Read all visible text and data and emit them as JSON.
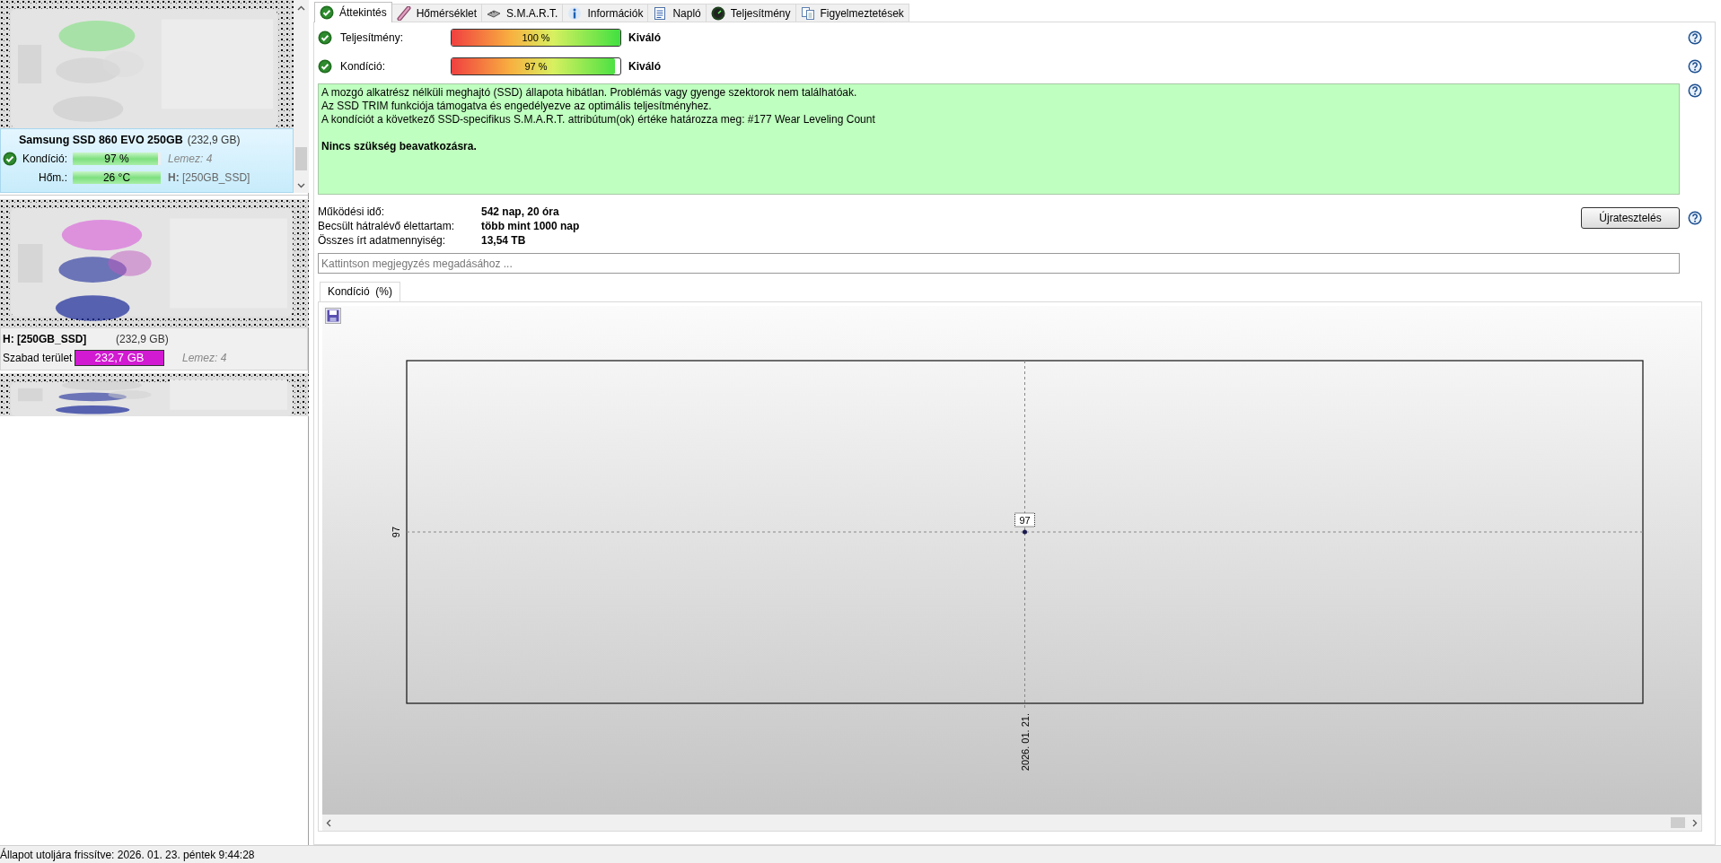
{
  "sidebar": {
    "disk": {
      "name": "Samsung SSD 860 EVO 250GB",
      "size": "(232,9 GB)",
      "selected": true,
      "condition": {
        "label": "Kondíció:",
        "value": "97 %",
        "level": 0.97
      },
      "disk_number": "Lemez: 4",
      "temperature": {
        "label": "Hőm.:",
        "value": "26 °C"
      },
      "volume": "**H:** [250GB_SSD]"
    },
    "partition": {
      "name": "H: [250GB_SSD]",
      "size": "(232,9 GB)",
      "selected": false,
      "free": {
        "label": "Szabad terület",
        "value": "232,7 GB",
        "level": 0.999
      },
      "disk_number": "Lemez: 4"
    }
  },
  "tabs": [
    {
      "label": "Áttekintés",
      "selected": true
    },
    {
      "label": "Hőmérséklet",
      "selected": false
    },
    {
      "label": "S.M.A.R.T.",
      "selected": false
    },
    {
      "label": "Információk",
      "selected": false
    },
    {
      "label": "Napló",
      "selected": false
    },
    {
      "label": "Teljesítmény",
      "selected": false
    },
    {
      "label": "Figyelmeztetések",
      "selected": false
    }
  ],
  "metrics": [
    {
      "label": "Teljesítmény:",
      "value": "100 %",
      "level": 1,
      "rating": "Kiváló"
    },
    {
      "label": "Kondíció:",
      "value": "97 %",
      "level": 0.97,
      "rating": "Kiváló"
    }
  ],
  "message": {
    "lines": [
      "A mozgó alkatrész nélküli meghajtó (SSD) állapota hibátlan. Problémás vagy gyenge szektorok nem találhatóak.",
      "Az SSD TRIM funkciója támogatva és engedélyezve az optimális teljesítményhez.",
      "A kondíciót a következő SSD-specifikus S.M.A.R.T. attribútum(ok) értéke határozza meg:  #177 Wear Leveling Count"
    ],
    "advice": "Nincs szükség beavatkozásra."
  },
  "info": [
    {
      "label": "Működési idő:",
      "value": "542 nap, 20 óra"
    },
    {
      "label": "Becsült hátralévő élettartam:",
      "value": "több mint 1000 nap"
    },
    {
      "label": "Összes írt adatmennyiség:",
      "value": "13,54 TB"
    }
  ],
  "retest_button": "Újratesztelés",
  "note_field": {
    "placeholder": "Kattintson megjegyzés megadásához ..."
  },
  "chart_tabs": [
    {
      "label": "Kondíció  (%)",
      "selected": true
    }
  ],
  "chart": {
    "y_axis_label": "97",
    "point_label": "97",
    "x_axis_label": "2026. 01. 21."
  },
  "status_bar": "Állapot utoljára frissítve: 2026. 01. 23. péntek 9:44:28"
}
